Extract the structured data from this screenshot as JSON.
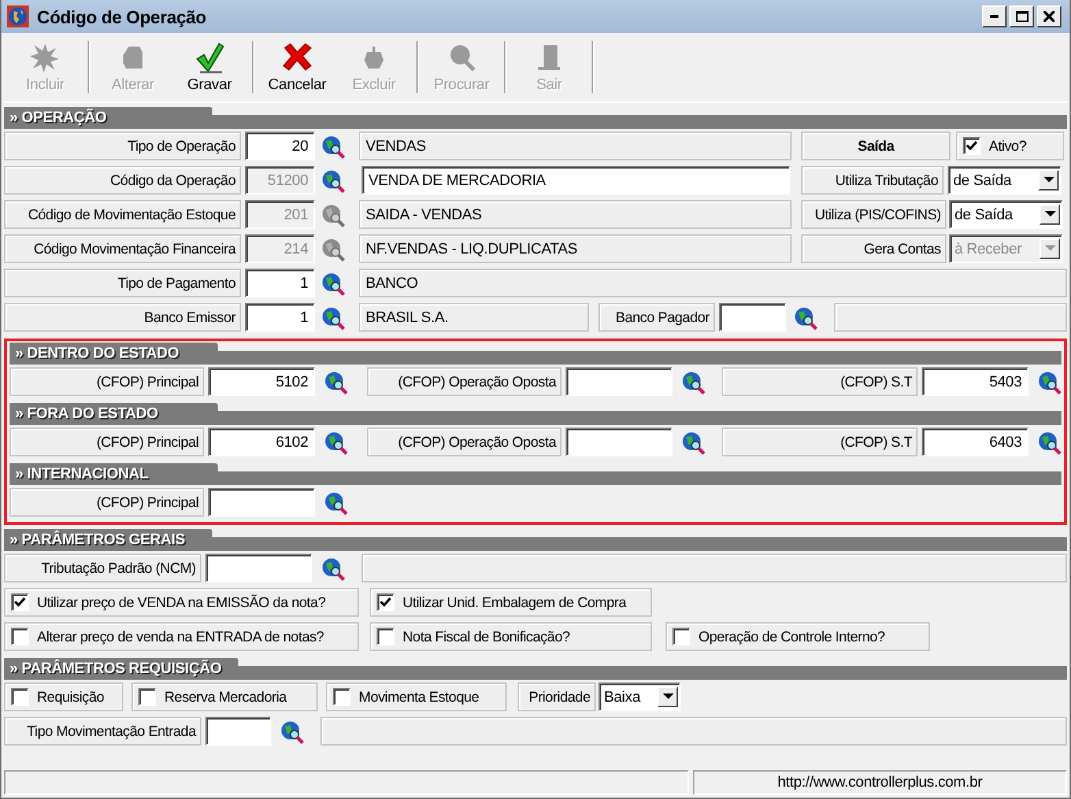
{
  "window": {
    "title": "Código de Operação"
  },
  "toolbar": [
    {
      "label": "Incluir",
      "disabled": true
    },
    {
      "label": "Alterar",
      "disabled": true
    },
    {
      "label": "Gravar",
      "disabled": false
    },
    {
      "label": "Cancelar",
      "disabled": false
    },
    {
      "label": "Excluir",
      "disabled": true
    },
    {
      "label": "Procurar",
      "disabled": true
    },
    {
      "label": "Sair",
      "disabled": true
    }
  ],
  "groups": [
    {
      "outlined": false,
      "sections": [
        {
          "title": "» OPERAÇÃO",
          "rows": [
            {
              "cells": [
                {
                  "kind": "label",
                  "text": "Tipo de Operação"
                },
                {
                  "kind": "input",
                  "value": "20",
                  "disabled": false
                },
                {
                  "kind": "lookup",
                  "disabled": false
                },
                {
                  "kind": "display",
                  "text": "VENDAS"
                },
                {
                  "kind": "caption",
                  "text": "Saída"
                },
                {
                  "kind": "check",
                  "label": "Ativo?",
                  "checked": true
                }
              ]
            },
            {
              "cells": [
                {
                  "kind": "label",
                  "text": "Código da Operação"
                },
                {
                  "kind": "input",
                  "value": "51200",
                  "disabled": true
                },
                {
                  "kind": "lookup",
                  "disabled": false
                },
                {
                  "kind": "field",
                  "value": "VENDA DE MERCADORIA"
                },
                {
                  "kind": "label",
                  "text": "Utiliza Tributação"
                },
                {
                  "kind": "combo",
                  "value": "de Saída",
                  "disabled": false
                }
              ]
            },
            {
              "cells": [
                {
                  "kind": "label",
                  "text": "Código de Movimentação Estoque"
                },
                {
                  "kind": "input",
                  "value": "201",
                  "disabled": true
                },
                {
                  "kind": "lookup",
                  "disabled": true
                },
                {
                  "kind": "display",
                  "text": "SAIDA - VENDAS"
                },
                {
                  "kind": "label",
                  "text": "Utiliza (PIS/COFINS)"
                },
                {
                  "kind": "combo",
                  "value": "de Saída",
                  "disabled": false
                }
              ]
            },
            {
              "cells": [
                {
                  "kind": "label",
                  "text": "Código Movimentação Financeira"
                },
                {
                  "kind": "input",
                  "value": "214",
                  "disabled": true
                },
                {
                  "kind": "lookup",
                  "disabled": true
                },
                {
                  "kind": "display",
                  "text": "NF.VENDAS - LIQ.DUPLICATAS"
                },
                {
                  "kind": "label",
                  "text": "Gera Contas"
                },
                {
                  "kind": "combo",
                  "value": "à Receber",
                  "disabled": true
                }
              ]
            },
            {
              "cells": [
                {
                  "kind": "label",
                  "text": "Tipo de Pagamento"
                },
                {
                  "kind": "input",
                  "value": "1",
                  "disabled": false
                },
                {
                  "kind": "lookup",
                  "disabled": false
                },
                {
                  "kind": "display",
                  "text": "BANCO"
                }
              ]
            },
            {
              "cells": [
                {
                  "kind": "label",
                  "text": "Banco Emissor"
                },
                {
                  "kind": "input",
                  "value": "1",
                  "disabled": false
                },
                {
                  "kind": "lookup",
                  "disabled": false
                },
                {
                  "kind": "display",
                  "text": "BRASIL S.A."
                },
                {
                  "kind": "label",
                  "text": "Banco Pagador"
                },
                {
                  "kind": "input",
                  "disabled": false
                },
                {
                  "kind": "lookup",
                  "disabled": false
                },
                {
                  "kind": "blank"
                }
              ]
            }
          ]
        }
      ]
    },
    {
      "outlined": true,
      "sections": [
        {
          "title": "» DENTRO DO ESTADO",
          "rows": [
            {
              "cells": [
                {
                  "kind": "label",
                  "text": "(CFOP) Principal"
                },
                {
                  "kind": "input",
                  "value": "5102",
                  "disabled": false
                },
                {
                  "kind": "lookup",
                  "disabled": false
                },
                {
                  "kind": "label",
                  "text": "(CFOP) Operação Oposta"
                },
                {
                  "kind": "input",
                  "disabled": false
                },
                {
                  "kind": "lookup",
                  "disabled": false
                },
                {
                  "kind": "label",
                  "text": "(CFOP) S.T"
                },
                {
                  "kind": "input",
                  "value": "5403",
                  "disabled": false
                },
                {
                  "kind": "lookup",
                  "disabled": false
                }
              ]
            }
          ]
        },
        {
          "title": "» FORA DO ESTADO",
          "rows": [
            {
              "cells": [
                {
                  "kind": "label",
                  "text": "(CFOP) Principal"
                },
                {
                  "kind": "input",
                  "value": "6102",
                  "disabled": false
                },
                {
                  "kind": "lookup",
                  "disabled": false
                },
                {
                  "kind": "label",
                  "text": "(CFOP) Operação Oposta"
                },
                {
                  "kind": "input",
                  "disabled": false
                },
                {
                  "kind": "lookup",
                  "disabled": false
                },
                {
                  "kind": "label",
                  "text": "(CFOP) S.T"
                },
                {
                  "kind": "input",
                  "value": "6403",
                  "disabled": false
                },
                {
                  "kind": "lookup",
                  "disabled": false
                }
              ]
            }
          ]
        },
        {
          "title": "» INTERNACIONAL",
          "rows": [
            {
              "cells": [
                {
                  "kind": "label",
                  "text": "(CFOP) Principal"
                },
                {
                  "kind": "input",
                  "disabled": false
                },
                {
                  "kind": "lookup",
                  "disabled": false
                }
              ]
            }
          ]
        }
      ]
    },
    {
      "outlined": false,
      "sections": [
        {
          "title": "» PARÂMETROS GERAIS",
          "rows": [
            {
              "cells": [
                {
                  "kind": "label",
                  "text": "Tributação Padrão (NCM)"
                },
                {
                  "kind": "input",
                  "disabled": false
                },
                {
                  "kind": "lookup",
                  "disabled": false
                },
                {
                  "kind": "blank"
                }
              ]
            },
            {
              "cells": [
                {
                  "kind": "check",
                  "label": "Utilizar preço de VENDA na EMISSÃO da nota?",
                  "checked": true
                },
                {
                  "kind": "check",
                  "label": "Utilizar Unid. Embalagem de Compra",
                  "checked": true
                }
              ]
            },
            {
              "cells": [
                {
                  "kind": "check",
                  "label": "Alterar preço de venda na ENTRADA de notas?",
                  "checked": false
                },
                {
                  "kind": "check",
                  "label": "Nota Fiscal de Bonificação?",
                  "checked": false
                },
                {
                  "kind": "check",
                  "label": "Operação de Controle Interno?",
                  "checked": false
                }
              ]
            }
          ]
        },
        {
          "title": "» PARÂMETROS REQUISIÇÃO",
          "rows": [
            {
              "cells": [
                {
                  "kind": "check",
                  "label": "Requisição",
                  "checked": false
                },
                {
                  "kind": "check",
                  "label": "Reserva Mercadoria",
                  "checked": false
                },
                {
                  "kind": "check",
                  "label": "Movimenta Estoque",
                  "checked": false
                },
                {
                  "kind": "label",
                  "text": "Prioridade"
                },
                {
                  "kind": "combo",
                  "value": "Baixa",
                  "disabled": false
                }
              ]
            },
            {
              "cells": [
                {
                  "kind": "label",
                  "text": "Tipo Movimentação Entrada"
                },
                {
                  "kind": "input",
                  "disabled": false
                },
                {
                  "kind": "lookup",
                  "disabled": false
                },
                {
                  "kind": "blank"
                }
              ]
            }
          ]
        }
      ]
    }
  ],
  "status_bar": {
    "url": "http://www.controllerplus.com.br"
  }
}
